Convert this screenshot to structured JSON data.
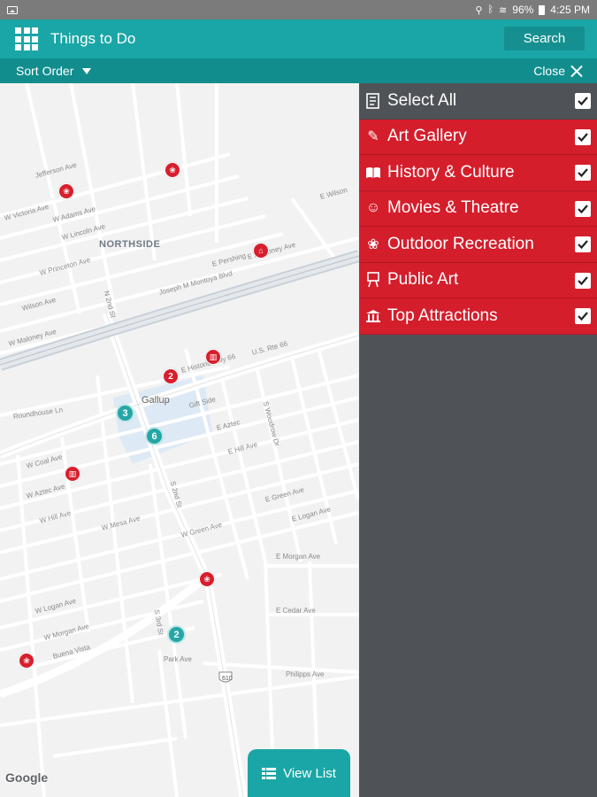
{
  "status_bar": {
    "battery": "96%",
    "time": "4:25 PM"
  },
  "toolbar": {
    "title": "Things to Do",
    "search_label": "Search"
  },
  "subbar": {
    "sort_label": "Sort Order",
    "close_label": "Close"
  },
  "map": {
    "area_label": "NORTHSIDE",
    "city_label": "Gallup",
    "google": "Google",
    "streets": {
      "jefferson": "Jefferson Ave",
      "victoria": "W Victoria Ave",
      "adams": "W Adams Ave",
      "lincoln": "W Lincoln Ave",
      "princeton": "W Princeton Ave",
      "wilson": "Wilson Ave",
      "maloney": "W Maloney Ave",
      "montoya": "Joseph M Montoya Blvd",
      "roundhouse": "Roundhouse Ln",
      "hwy66": "E Historic Hwy 66",
      "us66": "U.S. Rte 66",
      "coal": "W Coal Ave",
      "aztec": "W Aztec Ave",
      "hill": "W Hill Ave",
      "mesa": "W Mesa Ave",
      "logan": "W Logan Ave",
      "morgan": "W Morgan Ave",
      "buena_vista": "Buena Vista",
      "park": "Park Ave",
      "green": "W Green Ave",
      "e_aztec": "E Aztec",
      "e_hill": "E Hill Ave",
      "e_green": "E Green Ave",
      "e_logan": "E Logan Ave",
      "e_morgan": "E Morgan Ave",
      "e_cedar": "E Cedar Ave",
      "phillips": "Philipps Ave",
      "e_wilson": "E Wilson",
      "e_pershing": "E Pershing",
      "e_mahoney": "E Mahoney Ave",
      "e_hwy66": "E Hwy 66",
      "gift": "Gift Side",
      "n_2nd": "N 2nd St",
      "s_2nd": "S 2nd St",
      "s_3rd": "S 3rd St",
      "woodrow": "S Woodrow Dr",
      "route610": "610"
    },
    "clusters": [
      {
        "id": "red-2",
        "label": "2"
      },
      {
        "id": "teal-3",
        "label": "3"
      },
      {
        "id": "teal-6",
        "label": "6"
      },
      {
        "id": "teal-2",
        "label": "2"
      }
    ],
    "view_list_label": "View List"
  },
  "filters": {
    "select_all": {
      "label": "Select All",
      "checked": true
    },
    "items": [
      {
        "label": "Art Gallery",
        "icon": "palette-icon",
        "checked": true
      },
      {
        "label": "History & Culture",
        "icon": "open-book-icon",
        "checked": true
      },
      {
        "label": "Movies & Theatre",
        "icon": "theatre-masks-icon",
        "checked": true
      },
      {
        "label": "Outdoor Recreation",
        "icon": "hiker-icon",
        "checked": true
      },
      {
        "label": "Public Art",
        "icon": "easel-icon",
        "checked": true
      },
      {
        "label": "Top Attractions",
        "icon": "landmark-icon",
        "checked": true
      }
    ]
  },
  "colors": {
    "teal": "#1aa6a6",
    "teal_dark": "#128d8e",
    "red": "#d41e2c",
    "panel_gray": "#4f5358"
  }
}
